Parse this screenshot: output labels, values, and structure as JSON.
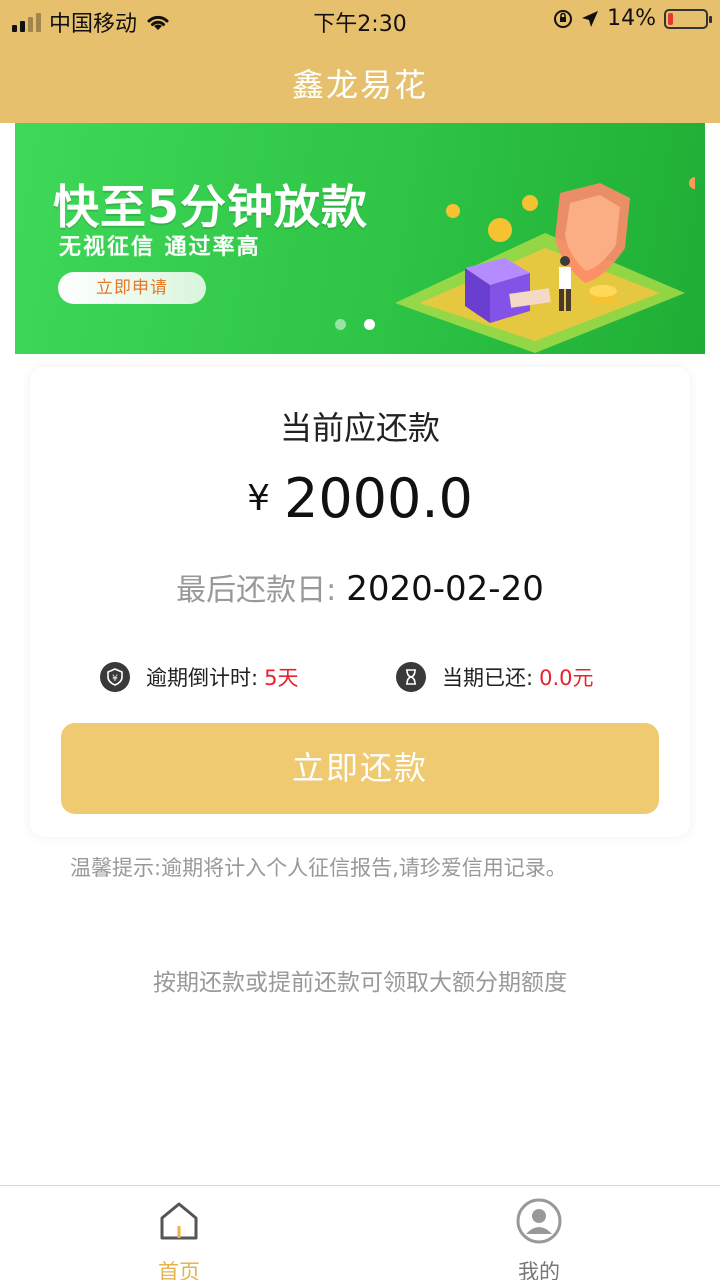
{
  "status_bar": {
    "carrier": "中国移动",
    "time": "下午2:30",
    "battery_percent": "14%",
    "battery_level": 0.14
  },
  "header": {
    "title": "鑫龙易花"
  },
  "banner": {
    "headline": "快至5分钟放款",
    "subline": "无视征信  通过率高",
    "button": "立即申请",
    "slides_count": 2,
    "active_slide": 1
  },
  "payment_card": {
    "title": "当前应还款",
    "currency": "¥",
    "amount": "2000.0",
    "due_label": "最后还款日:",
    "due_date": "2020-02-20",
    "overdue_label": "逾期倒计时:",
    "overdue_value": "5天",
    "paid_label": "当期已还:",
    "paid_value": "0.0元",
    "repay_button": "立即还款"
  },
  "tip": "温馨提示:逾期将计入个人征信报告,请珍爱信用记录。",
  "promo": "按期还款或提前还款可领取大额分期额度",
  "tabbar": {
    "items": [
      {
        "label": "首页",
        "icon": "home-icon",
        "active": true
      },
      {
        "label": "我的",
        "icon": "profile-icon",
        "active": false
      }
    ]
  },
  "colors": {
    "header": "#e6c06c",
    "repay_button": "#efca70",
    "banner_green": "#2ec446",
    "accent_red": "#e5232e",
    "tab_active": "#e6b34c"
  }
}
